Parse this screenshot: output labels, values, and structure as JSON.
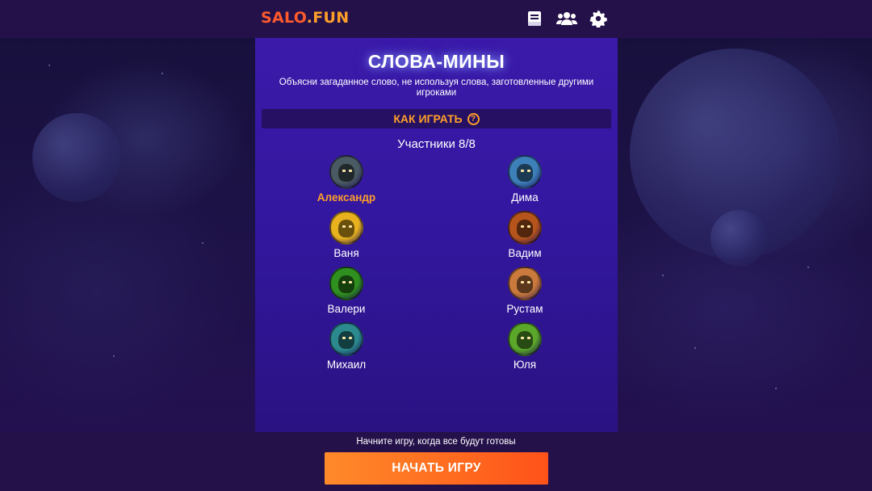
{
  "app": {
    "logo_part1": "SALO",
    "logo_part2": ".FUN"
  },
  "header": {
    "icons": [
      "rules-book-icon",
      "users-icon",
      "settings-gear-icon"
    ]
  },
  "game": {
    "title": "СЛОВА-МИНЫ",
    "subtitle": "Объясни загаданное слово, не используя слова, заготовленные другими игроками",
    "how_to_play": "КАК ИГРАТЬ",
    "how_to_play_icon": "?",
    "participants_label": "Участники 8/8"
  },
  "players": [
    {
      "name": "Александр",
      "is_me": true,
      "color": "#4a5a63"
    },
    {
      "name": "Дима",
      "is_me": false,
      "color": "#3d7fb8"
    },
    {
      "name": "Ваня",
      "is_me": false,
      "color": "#e8b21e"
    },
    {
      "name": "Вадим",
      "is_me": false,
      "color": "#b5551c"
    },
    {
      "name": "Валери",
      "is_me": false,
      "color": "#2f8f1f"
    },
    {
      "name": "Рустам",
      "is_me": false,
      "color": "#c97a3c"
    },
    {
      "name": "Михаил",
      "is_me": false,
      "color": "#2c8a8f"
    },
    {
      "name": "Юля",
      "is_me": false,
      "color": "#5aa72a"
    }
  ],
  "footer": {
    "hint": "Начните игру, когда все будут готовы",
    "start_button": "НАЧАТЬ ИГРУ"
  },
  "colors": {
    "accent_orange": "#ff9f2a",
    "logo_red": "#ff5a2b",
    "panel_purple": "#3b1aa9",
    "bar_dark": "#24114a"
  }
}
